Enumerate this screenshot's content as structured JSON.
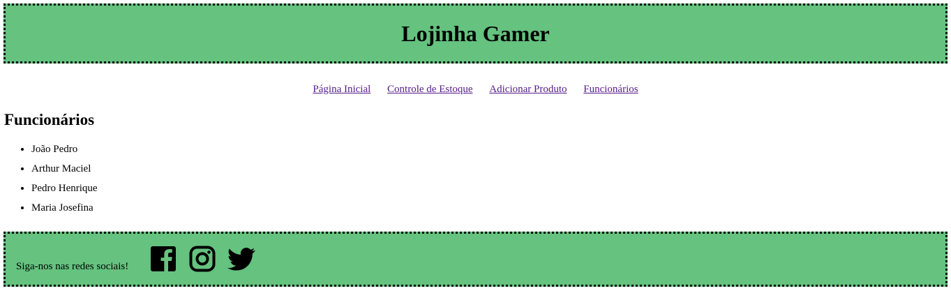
{
  "header": {
    "title": "Lojinha Gamer"
  },
  "nav": {
    "items": [
      {
        "label": "Página Inicial"
      },
      {
        "label": "Controle de Estoque"
      },
      {
        "label": "Adicionar Produto"
      },
      {
        "label": "Funcionários"
      }
    ]
  },
  "main": {
    "title": "Funcionários",
    "employees": [
      "João Pedro",
      "Arthur Maciel",
      "Pedro Henrique",
      "Maria Josefina"
    ]
  },
  "footer": {
    "label": "Siga-nos nas redes sociais!",
    "icons": [
      "facebook-icon",
      "instagram-icon",
      "twitter-icon"
    ]
  },
  "colors": {
    "banner_bg": "#65c27f",
    "link": "#551a8b"
  }
}
